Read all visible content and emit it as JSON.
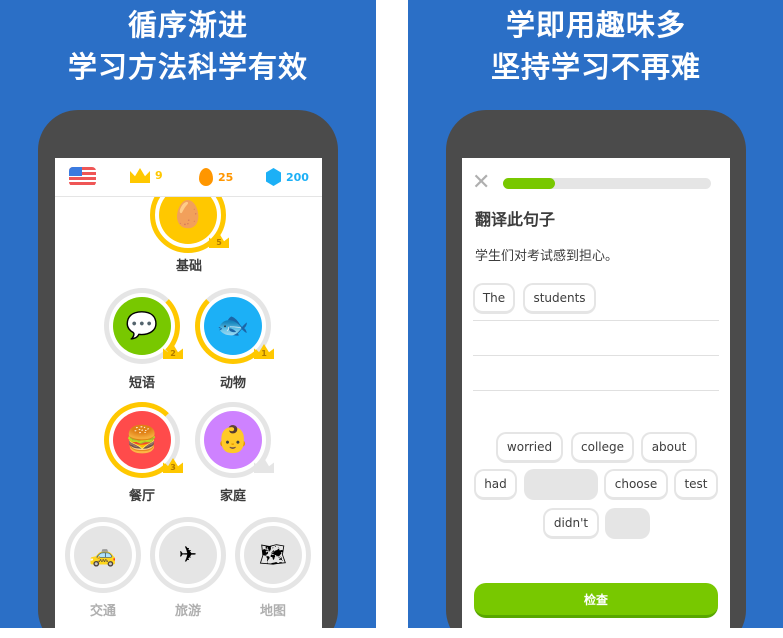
{
  "left": {
    "headline": [
      "循序渐进",
      "学习方法科学有效"
    ],
    "stats": {
      "flag_icon": "us-flag-icon",
      "crowns": "9",
      "streak": "25",
      "gems": "200"
    },
    "skills": [
      {
        "label": "基础",
        "crown": "5",
        "icon": "egg-icon",
        "color": "#ffc800"
      },
      {
        "label": "短语",
        "crown": "2",
        "icon": "chat-icon",
        "color": "#78c800"
      },
      {
        "label": "动物",
        "crown": "1",
        "icon": "fish-icon",
        "color": "#1cb0f6"
      },
      {
        "label": "餐厅",
        "crown": "3",
        "icon": "burger-icon",
        "color": "#ff4b4b"
      },
      {
        "label": "家庭",
        "crown": "",
        "icon": "baby-icon",
        "color": "#ce82ff"
      },
      {
        "label": "交通",
        "icon": "taxi-icon",
        "locked": true
      },
      {
        "label": "旅游",
        "icon": "plane-icon",
        "locked": true
      },
      {
        "label": "地图",
        "icon": "map-icon",
        "locked": true
      }
    ]
  },
  "right": {
    "headline": [
      "学即用趣味多",
      "坚持学习不再难"
    ],
    "progress": 0.25,
    "prompt_title": "翻译此句子",
    "sentence": "学生们对考试感到担心。",
    "answer": [
      "The",
      "students"
    ],
    "word_bank": [
      "worried",
      "college",
      "about",
      "had",
      "choose",
      "test",
      "didn't"
    ],
    "check_label": "检查",
    "accent": "#78c800"
  }
}
